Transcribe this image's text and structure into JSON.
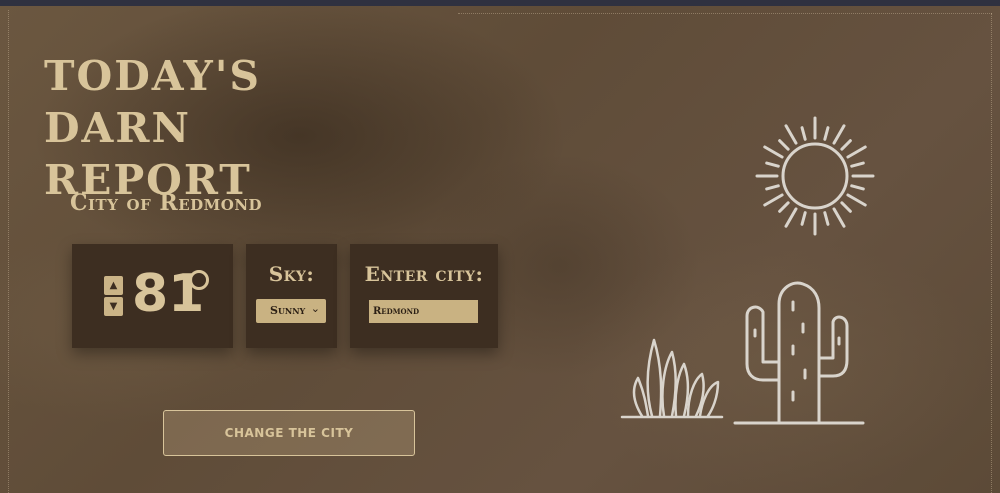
{
  "header": {
    "title": "Today's darn report",
    "city_heading": "City of Redmond"
  },
  "temperature": {
    "value": "81",
    "unit_symbol": "°",
    "increase_icon": "up-arrow-icon",
    "decrease_icon": "down-arrow-icon"
  },
  "sky": {
    "label": "Sky:",
    "selected": "Sunny"
  },
  "city_input": {
    "label": "Enter city:",
    "value": "Redmond"
  },
  "actions": {
    "change_city_label": "Change the city"
  },
  "illustrations": {
    "sky": "sun-icon",
    "landscape": [
      "grass-icon",
      "cactus-icon"
    ]
  },
  "colors": {
    "background": "#5f4c38",
    "card": "#3d2e21",
    "accent_text": "#d8c49a",
    "input_fill": "#c9b282",
    "line_art": "#d9d4cc"
  }
}
